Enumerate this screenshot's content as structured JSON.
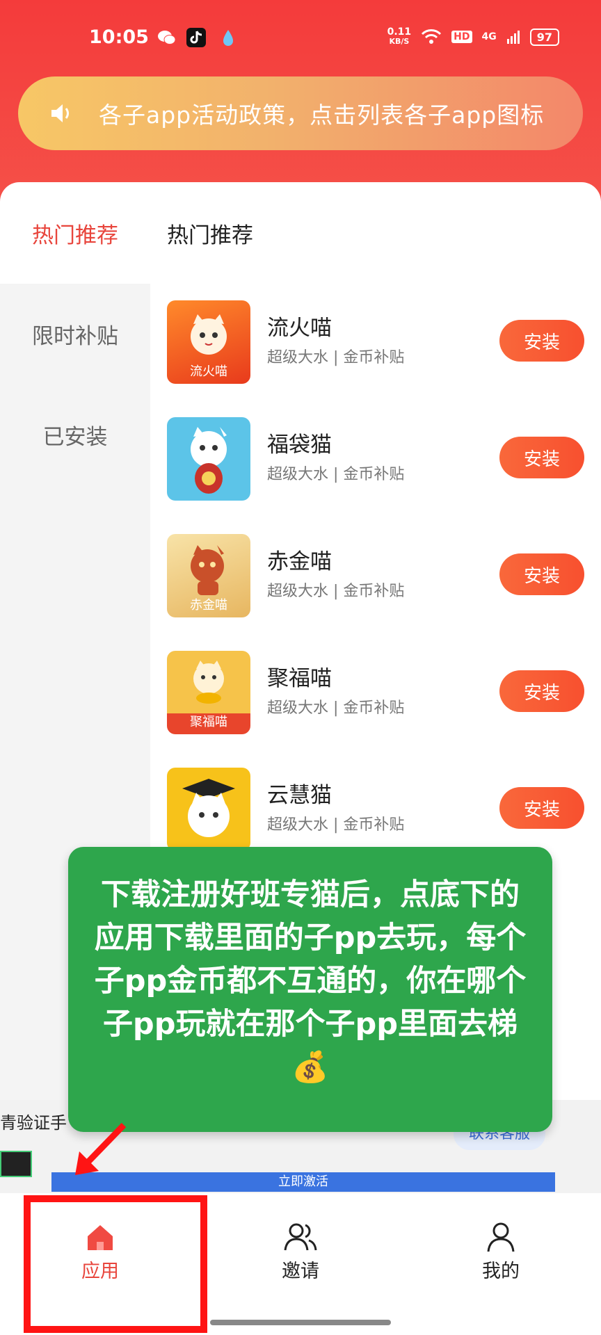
{
  "status_bar": {
    "time": "10:05",
    "net_speed_top": "0.11",
    "net_speed_unit": "KB/S",
    "hd": "HD",
    "network": "4G",
    "battery": "97"
  },
  "banner": {
    "text": "各子app活动政策，点击列表各子app图标"
  },
  "header": {
    "active_tab": "热门推荐",
    "section_title": "热门推荐"
  },
  "sidebar": {
    "items": [
      {
        "label": "限时补贴"
      },
      {
        "label": "已安装"
      }
    ]
  },
  "apps": [
    {
      "name": "流火喵",
      "tags": "超级大水 | 金币补贴",
      "button": "安装",
      "icon_label": "流火喵",
      "icon_colors": [
        "#f04a1e",
        "#ff8a2b"
      ]
    },
    {
      "name": "福袋猫",
      "tags": "超级大水 | 金币补贴",
      "button": "安装",
      "icon_label": "",
      "icon_colors": [
        "#5cc4e8",
        "#3ab0e0"
      ]
    },
    {
      "name": "赤金喵",
      "tags": "超级大水 | 金币补贴",
      "button": "安装",
      "icon_label": "赤金喵",
      "icon_colors": [
        "#f3d48a",
        "#e4a84a"
      ]
    },
    {
      "name": "聚福喵",
      "tags": "超级大水 | 金币补贴",
      "button": "安装",
      "icon_label": "聚福喵",
      "icon_colors": [
        "#f6c34a",
        "#e8452c"
      ]
    },
    {
      "name": "云慧猫",
      "tags": "超级大水 | 金币补贴",
      "button": "安装",
      "icon_label": "",
      "icon_colors": [
        "#f7c21a",
        "#f0b400"
      ]
    }
  ],
  "overlay": {
    "text": "下载注册好班专猫后，点底下的应用下载里面的子pp去玩，每个子pp金币都不互通的，你在哪个子pp玩就在那个子pp里面去梯💰"
  },
  "background_page": {
    "partial_text": "青验证手",
    "contact_button": "联系客服",
    "activate_button": "立即激活"
  },
  "bottom_nav": {
    "items": [
      {
        "label": "应用"
      },
      {
        "label": "邀请"
      },
      {
        "label": "我的"
      }
    ]
  },
  "colors": {
    "brand_red": "#f43b3b",
    "accent_orange": "#f8502f",
    "overlay_green": "#2ea64c",
    "active_tab": "#e8453c"
  }
}
